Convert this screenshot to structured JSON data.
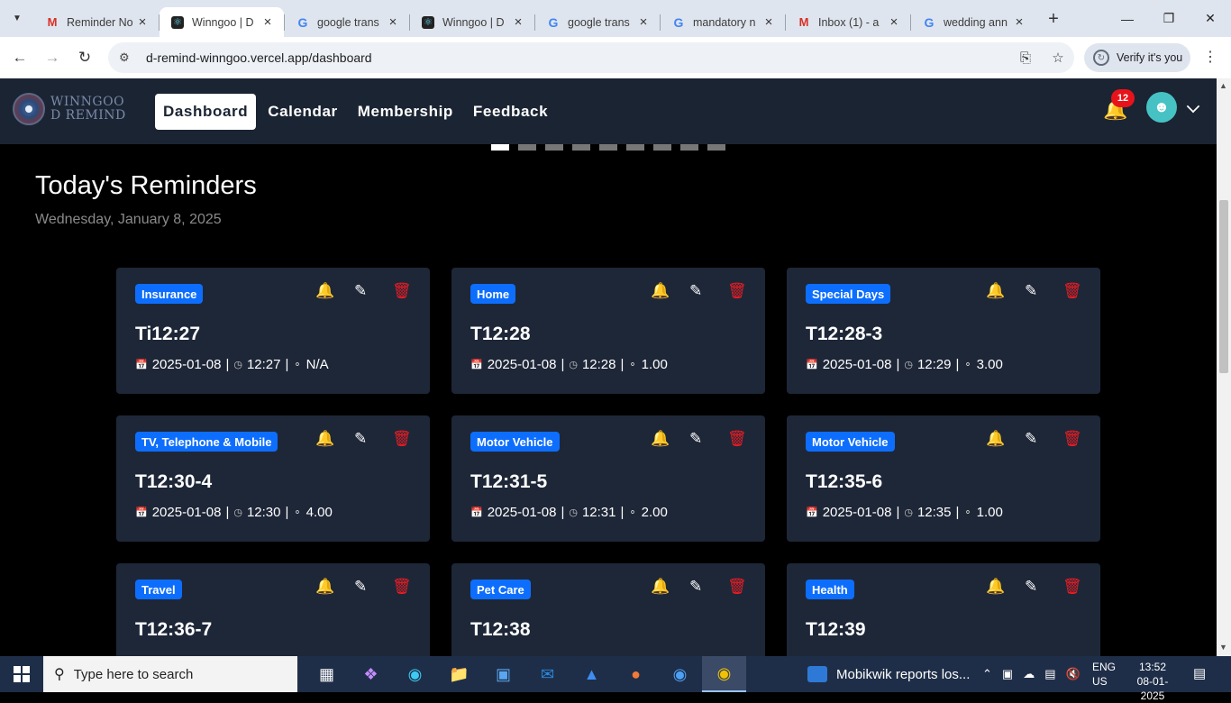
{
  "browser": {
    "tabs": [
      {
        "title": "Reminder No",
        "icon": "gmail-icon",
        "active": false
      },
      {
        "title": "Winngoo | D",
        "icon": "react-icon",
        "active": true
      },
      {
        "title": "google trans",
        "icon": "google-icon",
        "active": false
      },
      {
        "title": "Winngoo | D",
        "icon": "react-icon",
        "active": false
      },
      {
        "title": "google trans",
        "icon": "google-icon",
        "active": false
      },
      {
        "title": "mandatory n",
        "icon": "google-icon",
        "active": false
      },
      {
        "title": "Inbox (1) - a",
        "icon": "gmail-icon",
        "active": false
      },
      {
        "title": "wedding ann",
        "icon": "google-icon",
        "active": false
      }
    ],
    "url": "d-remind-winngoo.vercel.app/dashboard",
    "verify_label": "Verify it's you"
  },
  "site": {
    "logo_line1": "WINNGOO",
    "logo_line2": "D REMIND",
    "nav": [
      {
        "label": "Dashboard",
        "active": true
      },
      {
        "label": "Calendar",
        "active": false
      },
      {
        "label": "Membership",
        "active": false
      },
      {
        "label": "Feedback",
        "active": false
      }
    ],
    "notification_count": "12",
    "carousel_dots": 9,
    "carousel_active": 0
  },
  "page": {
    "heading": "Today's Reminders",
    "date": "Wednesday, January 8, 2025"
  },
  "reminders": [
    {
      "category": "Insurance",
      "title": "Ti12:27",
      "date": "2025-01-08",
      "time": "12:27",
      "amount": "N/A"
    },
    {
      "category": "Home",
      "title": "T12:28",
      "date": "2025-01-08",
      "time": "12:28",
      "amount": "1.00"
    },
    {
      "category": "Special Days",
      "title": "T12:28-3",
      "date": "2025-01-08",
      "time": "12:29",
      "amount": "3.00"
    },
    {
      "category": "TV, Telephone & Mobile",
      "title": "T12:30-4",
      "date": "2025-01-08",
      "time": "12:30",
      "amount": "4.00"
    },
    {
      "category": "Motor Vehicle",
      "title": "T12:31-5",
      "date": "2025-01-08",
      "time": "12:31",
      "amount": "2.00"
    },
    {
      "category": "Motor Vehicle",
      "title": "T12:35-6",
      "date": "2025-01-08",
      "time": "12:35",
      "amount": "1.00"
    },
    {
      "category": "Travel",
      "title": "T12:36-7",
      "date": "",
      "time": "",
      "amount": ""
    },
    {
      "category": "Pet Care",
      "title": "T12:38",
      "date": "",
      "time": "",
      "amount": ""
    },
    {
      "category": "Health",
      "title": "T12:39",
      "date": "",
      "time": "",
      "amount": ""
    }
  ],
  "taskbar": {
    "search_placeholder": "Type here to search",
    "news": "Mobikwik reports los...",
    "lang": "ENG",
    "region": "US",
    "time": "13:52",
    "date": "08-01-2025"
  }
}
